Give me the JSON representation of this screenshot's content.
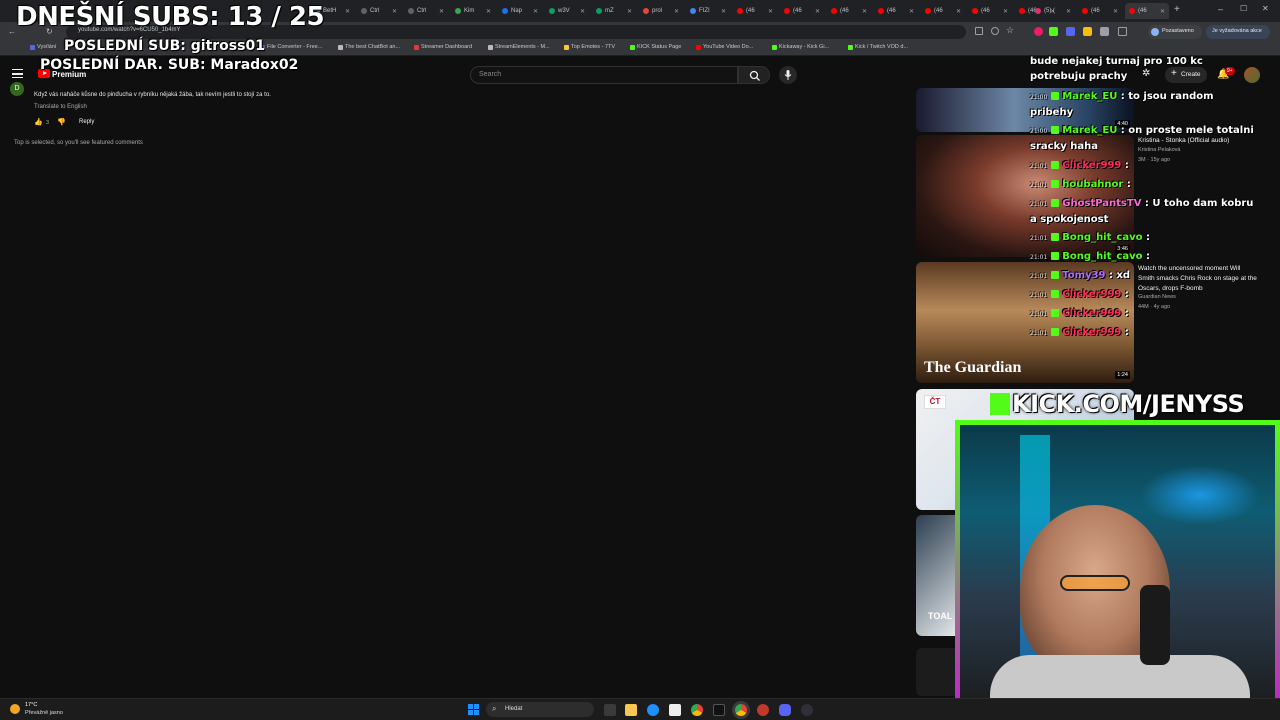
{
  "overlay": {
    "subs": "DNEŠNÍ SUBS: 13 / 25",
    "last_sub": "POSLEDNÍ SUB: gitross01",
    "last_donation_sub": "POSLEDNÍ DAR. SUB: Maradox02",
    "kick_url": "KICK.COM/JENYSS"
  },
  "browser": {
    "tabs": [
      "BetH",
      "Ctrl",
      "Ctrl",
      "Kim",
      "Nap",
      "w3V",
      "mZ",
      "prol",
      "FIZI",
      "(46",
      "(46",
      "(46",
      "(46",
      "(46",
      "(46",
      "(46",
      "(5) (",
      "(46",
      "(46"
    ],
    "url": "youtube.com/watch?v=6CU50_1b4mY",
    "profile_status": "Pozastaveno",
    "extra_status": "Je vyžadována akce",
    "bookmarks": [
      "Vysílání",
      "File Converter - Free...",
      "The best ChatBot an...",
      "Streamer Dashboard",
      "StreamElements - M...",
      "Top Emotes - 7TV",
      "KICK Status Page",
      "YouTube Video Do...",
      "Kickaway - Kick Gi...",
      "Kick / Twitch VOD d..."
    ]
  },
  "youtube": {
    "logo_text": "Premium",
    "search_placeholder": "Search",
    "create_label": "Create",
    "notif_count": "9+",
    "comment": {
      "avatar_letter": "D",
      "text": "Když vás naháče kůsne do pinďucha v rybníku nějaká žába, tak nevím jestli to stojí za to.",
      "translate": "Translate to English",
      "likes": "3",
      "reply": "Reply",
      "footer": "Top is selected, so you'll see featured comments"
    },
    "related": [
      {
        "duration": "4:40"
      },
      {
        "title": "Kristina - Stonka (Official audio)",
        "channel": "Kristina Pelaková",
        "views": "3M · 15y ago",
        "duration": "3:46"
      },
      {
        "title": "Watch the uncensored moment Will Smith smacks Chris Rock on stage at the Oscars, drops F-bomb",
        "channel": "Guardian News",
        "views": "44M · 4y ago",
        "duration": "1:24",
        "brand": "The Guardian"
      },
      {
        "brand": "ČT"
      },
      {
        "label": "TOAL"
      }
    ]
  },
  "chat": [
    {
      "time": "",
      "user": "",
      "text": "bude nejakej turnaj pro 100 kc potrebuju prachy",
      "color": "#ffffff"
    },
    {
      "time": "21:00",
      "user": "Marek_EU",
      "text": "to jsou random pribehy",
      "color": "#53fc18"
    },
    {
      "time": "21:00",
      "user": "Marek_EU",
      "text": "on proste mele totalni sracky haha",
      "color": "#53fc18"
    },
    {
      "time": "21:01",
      "user": "Clicker999",
      "text": "",
      "color": "#ff2d55"
    },
    {
      "time": "21:01",
      "user": "houbahnor",
      "text": "",
      "color": "#53fc18"
    },
    {
      "time": "21:01",
      "user": "GhostPantsTV",
      "text": "U toho dam kobru a spokojenost",
      "color": "#ff6ad5"
    },
    {
      "time": "21:01",
      "user": "Bong_hit_cavo",
      "text": "",
      "color": "#53fc18"
    },
    {
      "time": "21:01",
      "user": "Bong_hit_cavo",
      "text": "",
      "color": "#53fc18"
    },
    {
      "time": "21:01",
      "user": "Tomy39",
      "text": "xd",
      "color": "#b36bff"
    },
    {
      "time": "21:01",
      "user": "Clicker999",
      "text": "",
      "color": "#ff2d55"
    },
    {
      "time": "21:01",
      "user": "Clicker999",
      "text": "",
      "color": "#ff2d55"
    },
    {
      "time": "21:01",
      "user": "Clicker999",
      "text": "",
      "color": "#ff2d55"
    }
  ],
  "taskbar": {
    "weather_temp": "17°C",
    "weather_desc": "Převážně jasno",
    "search_label": "Hledat"
  },
  "colors": {
    "kick_green": "#53fc18",
    "yt_red": "#ff0000",
    "bg": "#0f0f0f"
  }
}
